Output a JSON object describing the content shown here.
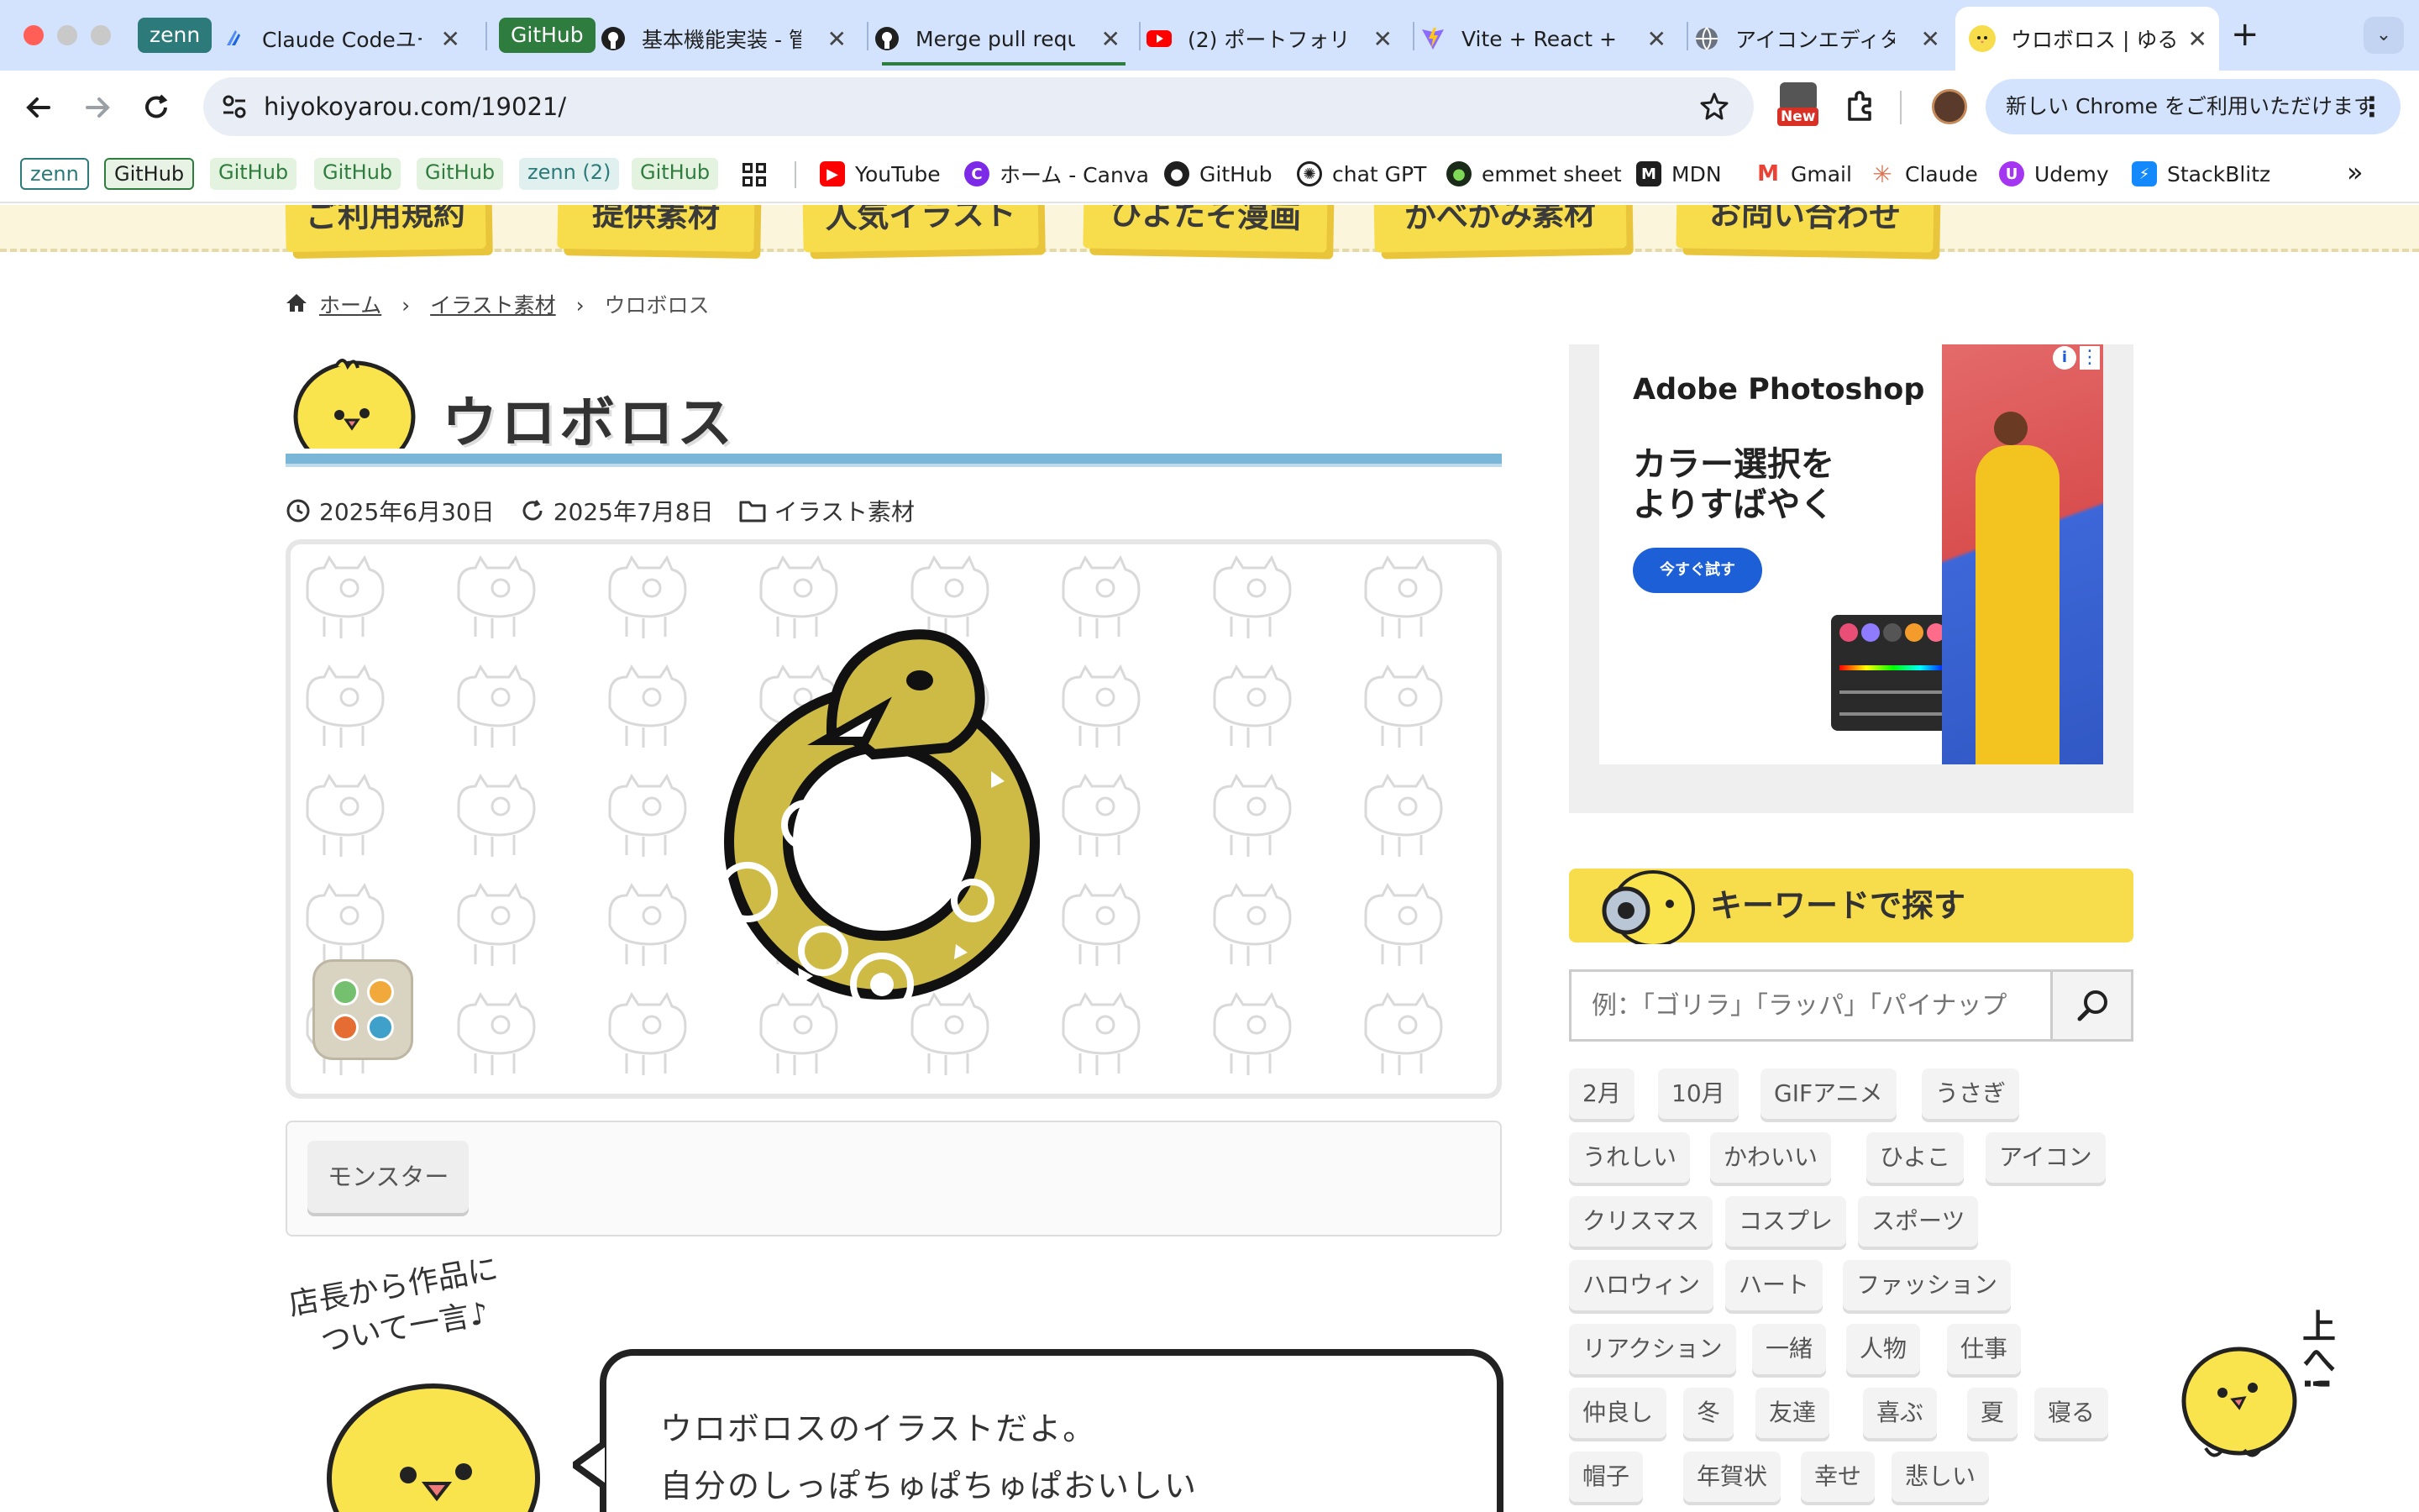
{
  "browser": {
    "tab_pills": [
      {
        "label": "zenn",
        "color": "#2d7a7a"
      },
      {
        "label": "GitHub",
        "color": "#2f7d3e"
      }
    ],
    "tabs": [
      {
        "title": "Claude Codeユー",
        "icon": "claude-code-icon"
      },
      {
        "title": "基本機能実装 - 管",
        "icon": "github-icon"
      },
      {
        "title": "Merge pull requ",
        "icon": "github-icon"
      },
      {
        "title": "(2) ポートフォリ",
        "icon": "youtube-icon"
      },
      {
        "title": "Vite + React + T",
        "icon": "vite-icon"
      },
      {
        "title": "アイコンエディタ",
        "icon": "globe-icon"
      },
      {
        "title": "ウロボロス | ゆる",
        "icon": "chick-icon",
        "active": true
      }
    ],
    "new_tab": "+",
    "url": "hiyokoyarou.com/19021/",
    "new_badge": "New",
    "update_button": "新しい Chrome をご利用いただけます",
    "bookmark_pills": [
      {
        "label": "zenn",
        "color": "#2d7a7a"
      },
      {
        "label": "GitHub",
        "color": "#2f7d3e"
      },
      {
        "label": "GitHub",
        "color": "#2f7d3e"
      },
      {
        "label": "GitHub",
        "color": "#2f7d3e"
      },
      {
        "label": "GitHub",
        "color": "#2f7d3e"
      },
      {
        "label": "zenn (2)",
        "color": "#2d7a7a"
      },
      {
        "label": "GitHub",
        "color": "#2f7d3e"
      }
    ],
    "bookmarks": [
      {
        "label": "YouTube",
        "icon": "youtube-icon"
      },
      {
        "label": "ホーム - Canva",
        "icon": "canva-icon"
      },
      {
        "label": "GitHub",
        "icon": "github-icon"
      },
      {
        "label": "chat GPT",
        "icon": "openai-icon"
      },
      {
        "label": "emmet sheet",
        "icon": "emmet-icon"
      },
      {
        "label": "MDN",
        "icon": "mdn-icon"
      },
      {
        "label": "Gmail",
        "icon": "gmail-icon"
      },
      {
        "label": "Claude",
        "icon": "claude-icon"
      },
      {
        "label": "Udemy",
        "icon": "udemy-icon"
      },
      {
        "label": "StackBlitz",
        "icon": "stackblitz-icon"
      }
    ],
    "more_bookmarks": "»"
  },
  "site": {
    "nav": [
      "ご利用規約",
      "提供素材",
      "人気イラスト",
      "ひよたそ漫画",
      "かべがみ素材",
      "お問い合わせ"
    ],
    "breadcrumb": {
      "home": "ホーム",
      "category": "イラスト素材",
      "current": "ウロボロス"
    },
    "title": "ウロボロス",
    "published": "2025年6月30日",
    "updated": "2025年7月8日",
    "category": "イラスト素材",
    "tag": "モンスター",
    "shop_note_line1": "店長から作品に",
    "shop_note_line2": "ついて一言♪",
    "comment_line1": "ウロボロスのイラストだよ。",
    "comment_line2": "自分のしっぽちゅぱちゅぱおいしい"
  },
  "ad": {
    "brand": "Adobe Photoshop",
    "headline1": "カラー選択を",
    "headline2": "よりすばやく",
    "cta": "今すぐ試す"
  },
  "sidebar": {
    "keyword_heading": "キーワードで探す",
    "search_placeholder": "例：「ゴリラ」「ラッパ」「パイナップ",
    "tags": [
      "2月",
      "10月",
      "GIFアニメ",
      "うさぎ",
      "うれしい",
      "かわいい",
      "ひよこ",
      "アイコン",
      "クリスマス",
      "コスプレ",
      "スポーツ",
      "ハロウィン",
      "ハート",
      "ファッション",
      "リアクション",
      "一緒",
      "人物",
      "仕事",
      "仲良し",
      "冬",
      "友達",
      "喜ぶ",
      "夏",
      "寝る",
      "帽子",
      "年賀状",
      "幸せ",
      "悲しい"
    ]
  },
  "to_top": "上へ!",
  "colors": {
    "accent_yellow": "#f7dd4b",
    "title_line": "#79b6d8",
    "chrome_tabbar": "#d3e3fd",
    "snake": "#cdbb45"
  }
}
